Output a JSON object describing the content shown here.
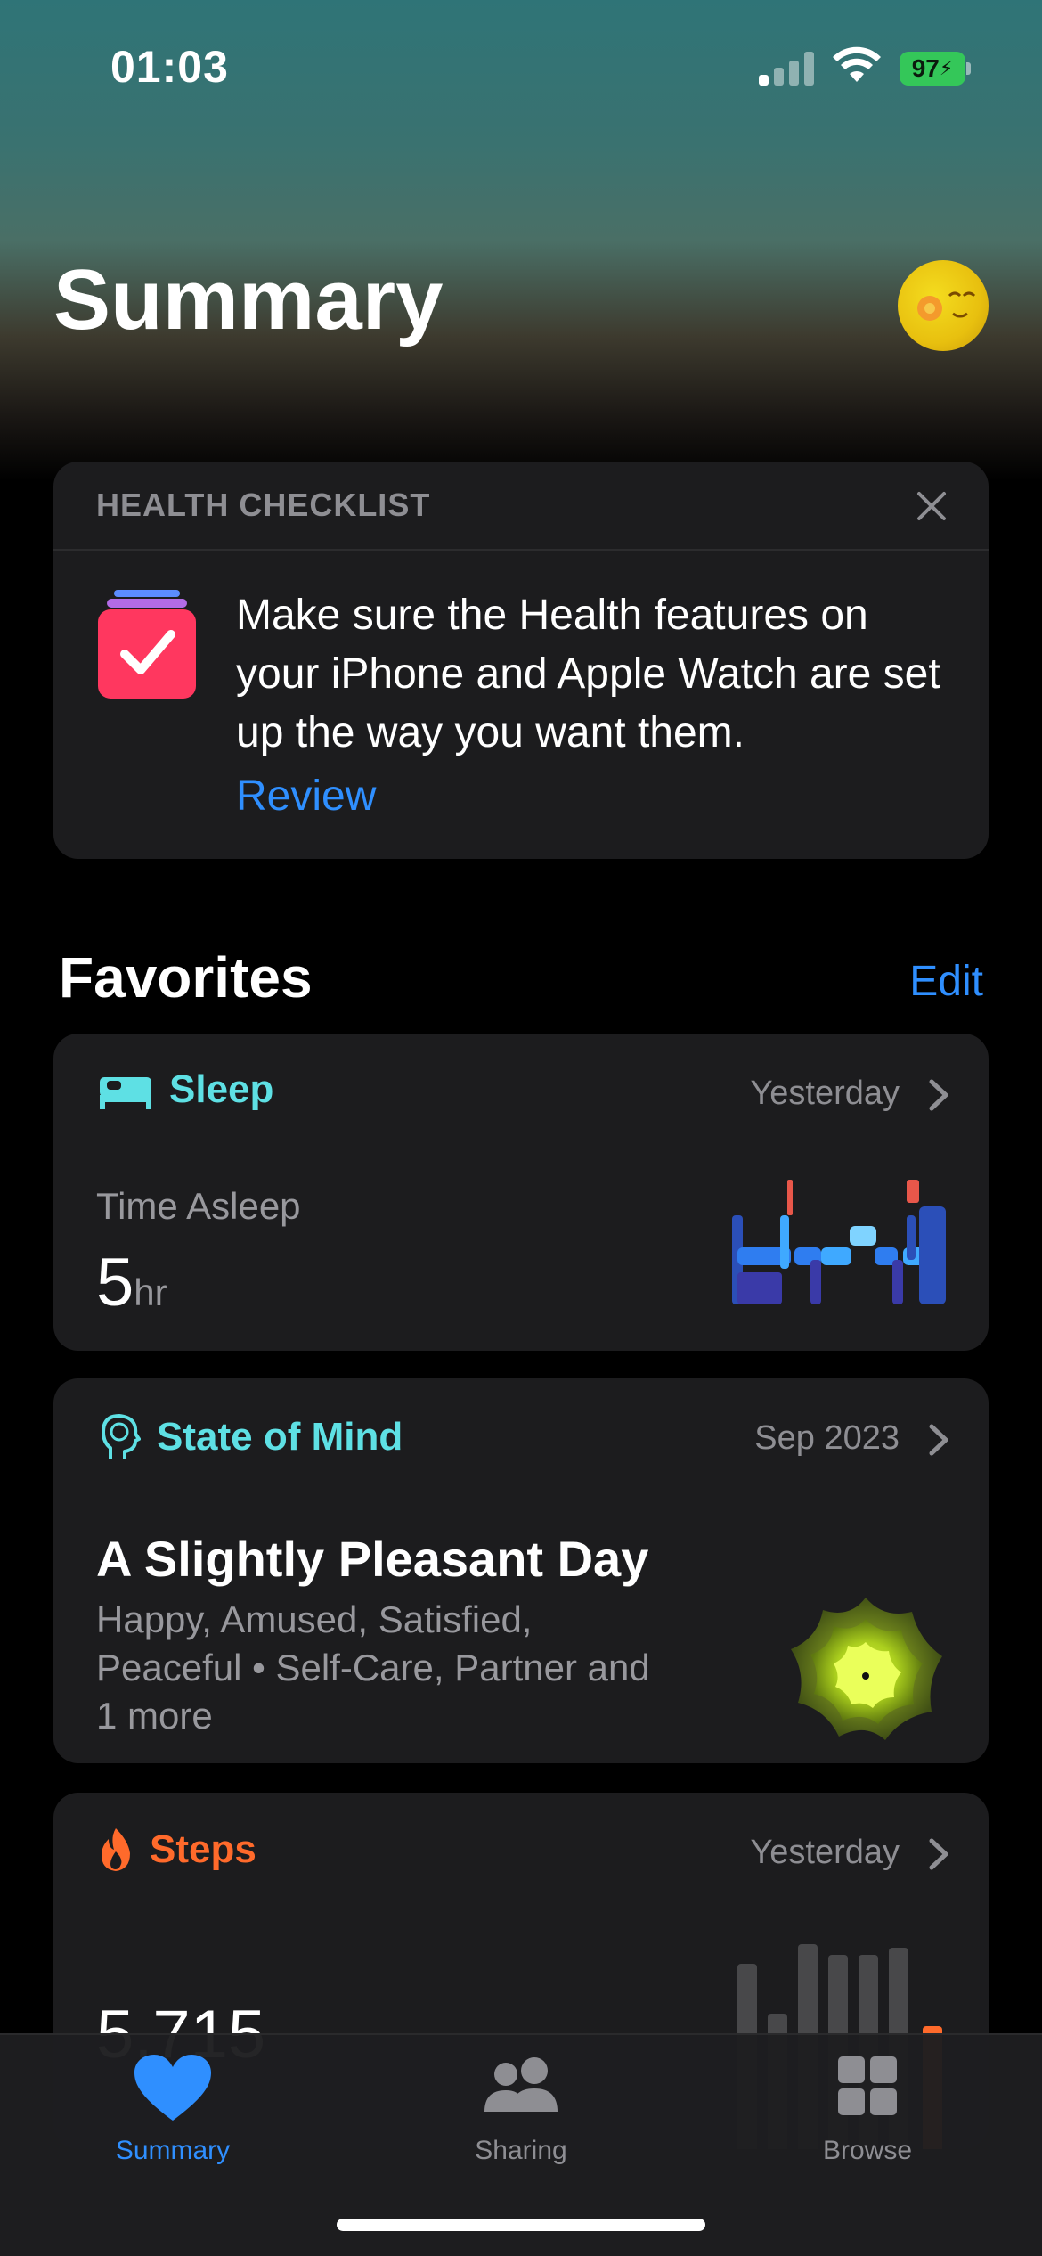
{
  "status_bar": {
    "time": "01:03",
    "battery_level": "97"
  },
  "header": {
    "title": "Summary"
  },
  "checklist": {
    "title": "HEALTH CHECKLIST",
    "message": "Make sure the Health features on your iPhone and Apple Watch are set up the way you want them.",
    "action": "Review"
  },
  "favorites": {
    "title": "Favorites",
    "edit_label": "Edit",
    "sleep": {
      "name": "Sleep",
      "date": "Yesterday",
      "metric_label": "Time Asleep",
      "value": "5",
      "unit": "hr",
      "accent": "#5ee0e4"
    },
    "state_of_mind": {
      "name": "State of Mind",
      "date": "Sep 2023",
      "headline": "A Slightly Pleasant Day",
      "details": "Happy, Amused, Satisfied, Peaceful • Self-Care, Partner and 1 more",
      "accent": "#5ee0e4"
    },
    "steps": {
      "name": "Steps",
      "date": "Yesterday",
      "value": "5,715",
      "accent": "#ff6a2b"
    }
  },
  "tab_bar": {
    "tabs": [
      {
        "label": "Summary",
        "icon": "heart-icon",
        "active": true
      },
      {
        "label": "Sharing",
        "icon": "people-icon",
        "active": false
      },
      {
        "label": "Browse",
        "icon": "grid-icon",
        "active": false
      }
    ]
  },
  "colors": {
    "link": "#2f8fff",
    "card": "#1c1c1e"
  }
}
